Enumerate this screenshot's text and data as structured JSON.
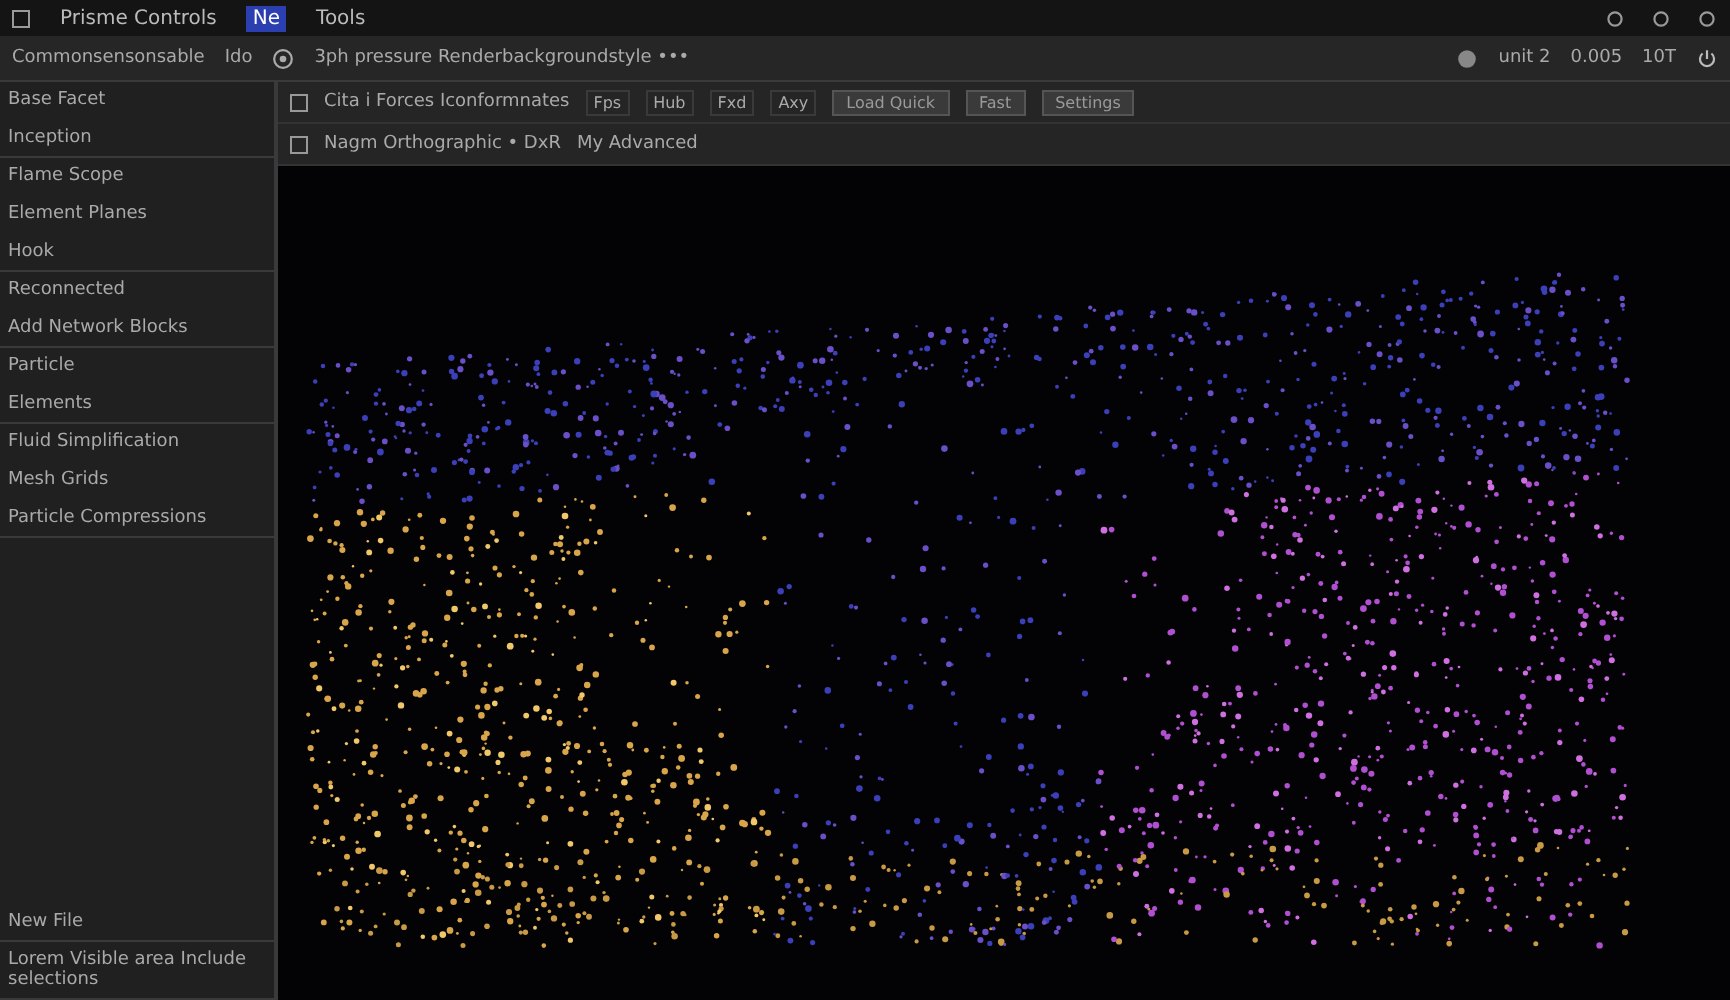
{
  "menu_bar": {
    "items": [
      {
        "label": "Prisme Controls",
        "selected": false
      },
      {
        "label": "Ne",
        "selected": true
      },
      {
        "label": "Tools",
        "selected": false
      }
    ]
  },
  "toolbar": {
    "left_label": "Commonsensonsable",
    "field_label": "Ido",
    "path": "3ph pressure Renderbackgroundstyle •••",
    "right_items": [
      "unit 2",
      "0.005",
      "10T"
    ]
  },
  "sidebar": {
    "sections": [
      {
        "items": [
          "Base Facet",
          "Inception"
        ]
      },
      {
        "items": [
          "Flame Scope",
          "Element Planes",
          "Hook"
        ]
      },
      {
        "items": [
          "Reconnected",
          "Add Network Blocks"
        ]
      },
      {
        "items": [
          "Particle",
          "Elements"
        ]
      },
      {
        "items": [
          "Fluid Simplification",
          "Mesh Grids",
          "Particle Compressions"
        ]
      },
      {
        "items": [
          "New File"
        ]
      },
      {
        "items": [
          "Lorem Visible area Include selections"
        ]
      }
    ]
  },
  "viewport": {
    "toolbar_row_1": {
      "title": "Cita i Forces Iconformnates",
      "tools": [
        "Fps",
        "Hub",
        "Fxd",
        "Axy"
      ],
      "buttons": [
        "Load Quick",
        "Fast",
        "Settings"
      ]
    },
    "toolbar_row_2": {
      "title": "Nagm Orthographic • DxR",
      "mode": "My Advanced"
    }
  }
}
